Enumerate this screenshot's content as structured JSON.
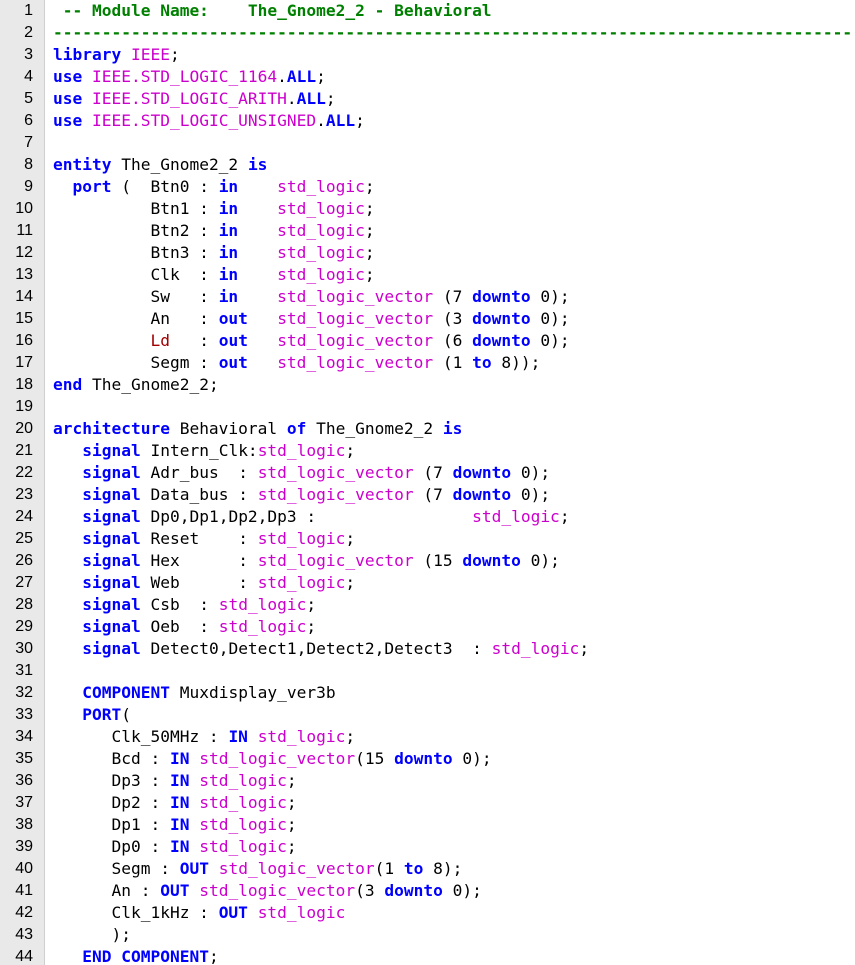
{
  "colors": {
    "keyword": "#0000ff",
    "type": "#cc00cc",
    "comment": "#008000",
    "identifier": "#000000",
    "highlight_identifier": "#a00000",
    "gutter_bg": "#e9e9e9"
  },
  "lines": [
    {
      "n": "1",
      "tokens": [
        {
          "t": "cm",
          "v": " -- Module Name:    The_Gnome2_2 - Behavioral"
        }
      ]
    },
    {
      "n": "2",
      "tokens": [
        {
          "t": "cm",
          "v": "----------------------------------------------------------------------------------"
        }
      ]
    },
    {
      "n": "3",
      "tokens": [
        {
          "t": "kw",
          "v": "library"
        },
        {
          "t": "id",
          "v": " "
        },
        {
          "t": "ty",
          "v": "IEEE"
        },
        {
          "t": "id",
          "v": ";"
        }
      ]
    },
    {
      "n": "4",
      "tokens": [
        {
          "t": "kw",
          "v": "use"
        },
        {
          "t": "id",
          "v": " "
        },
        {
          "t": "ty",
          "v": "IEEE.STD_LOGIC_1164"
        },
        {
          "t": "id",
          "v": "."
        },
        {
          "t": "kw",
          "v": "ALL"
        },
        {
          "t": "id",
          "v": ";"
        }
      ]
    },
    {
      "n": "5",
      "tokens": [
        {
          "t": "kw",
          "v": "use"
        },
        {
          "t": "id",
          "v": " "
        },
        {
          "t": "ty",
          "v": "IEEE.STD_LOGIC_ARITH"
        },
        {
          "t": "id",
          "v": "."
        },
        {
          "t": "kw",
          "v": "ALL"
        },
        {
          "t": "id",
          "v": ";"
        }
      ]
    },
    {
      "n": "6",
      "tokens": [
        {
          "t": "kw",
          "v": "use"
        },
        {
          "t": "id",
          "v": " "
        },
        {
          "t": "ty",
          "v": "IEEE.STD_LOGIC_UNSIGNED"
        },
        {
          "t": "id",
          "v": "."
        },
        {
          "t": "kw",
          "v": "ALL"
        },
        {
          "t": "id",
          "v": ";"
        }
      ]
    },
    {
      "n": "7",
      "tokens": []
    },
    {
      "n": "8",
      "tokens": [
        {
          "t": "kw",
          "v": "entity"
        },
        {
          "t": "id",
          "v": " The_Gnome2_2 "
        },
        {
          "t": "kw",
          "v": "is"
        }
      ]
    },
    {
      "n": "9",
      "tokens": [
        {
          "t": "id",
          "v": "  "
        },
        {
          "t": "kw",
          "v": "port"
        },
        {
          "t": "id",
          "v": " (  Btn0 : "
        },
        {
          "t": "kw",
          "v": "in"
        },
        {
          "t": "id",
          "v": "    "
        },
        {
          "t": "ty",
          "v": "std_logic"
        },
        {
          "t": "id",
          "v": ";"
        }
      ]
    },
    {
      "n": "10",
      "tokens": [
        {
          "t": "id",
          "v": "          Btn1 : "
        },
        {
          "t": "kw",
          "v": "in"
        },
        {
          "t": "id",
          "v": "    "
        },
        {
          "t": "ty",
          "v": "std_logic"
        },
        {
          "t": "id",
          "v": ";"
        }
      ]
    },
    {
      "n": "11",
      "tokens": [
        {
          "t": "id",
          "v": "          Btn2 : "
        },
        {
          "t": "kw",
          "v": "in"
        },
        {
          "t": "id",
          "v": "    "
        },
        {
          "t": "ty",
          "v": "std_logic"
        },
        {
          "t": "id",
          "v": ";"
        }
      ]
    },
    {
      "n": "12",
      "tokens": [
        {
          "t": "id",
          "v": "          Btn3 : "
        },
        {
          "t": "kw",
          "v": "in"
        },
        {
          "t": "id",
          "v": "    "
        },
        {
          "t": "ty",
          "v": "std_logic"
        },
        {
          "t": "id",
          "v": ";"
        }
      ]
    },
    {
      "n": "13",
      "tokens": [
        {
          "t": "id",
          "v": "          Clk  : "
        },
        {
          "t": "kw",
          "v": "in"
        },
        {
          "t": "id",
          "v": "    "
        },
        {
          "t": "ty",
          "v": "std_logic"
        },
        {
          "t": "id",
          "v": ";"
        }
      ]
    },
    {
      "n": "14",
      "tokens": [
        {
          "t": "id",
          "v": "          Sw   : "
        },
        {
          "t": "kw",
          "v": "in"
        },
        {
          "t": "id",
          "v": "    "
        },
        {
          "t": "ty",
          "v": "std_logic_vector"
        },
        {
          "t": "id",
          "v": " (7 "
        },
        {
          "t": "kw",
          "v": "downto"
        },
        {
          "t": "id",
          "v": " 0);"
        }
      ]
    },
    {
      "n": "15",
      "tokens": [
        {
          "t": "id",
          "v": "          An   : "
        },
        {
          "t": "kw",
          "v": "out"
        },
        {
          "t": "id",
          "v": "   "
        },
        {
          "t": "ty",
          "v": "std_logic_vector"
        },
        {
          "t": "id",
          "v": " (3 "
        },
        {
          "t": "kw",
          "v": "downto"
        },
        {
          "t": "id",
          "v": " 0);"
        }
      ]
    },
    {
      "n": "16",
      "tokens": [
        {
          "t": "id",
          "v": "          "
        },
        {
          "t": "rd",
          "v": "Ld"
        },
        {
          "t": "id",
          "v": "   : "
        },
        {
          "t": "kw",
          "v": "out"
        },
        {
          "t": "id",
          "v": "   "
        },
        {
          "t": "ty",
          "v": "std_logic_vector"
        },
        {
          "t": "id",
          "v": " (6 "
        },
        {
          "t": "kw",
          "v": "downto"
        },
        {
          "t": "id",
          "v": " 0);"
        }
      ]
    },
    {
      "n": "17",
      "tokens": [
        {
          "t": "id",
          "v": "          Segm : "
        },
        {
          "t": "kw",
          "v": "out"
        },
        {
          "t": "id",
          "v": "   "
        },
        {
          "t": "ty",
          "v": "std_logic_vector"
        },
        {
          "t": "id",
          "v": " (1 "
        },
        {
          "t": "kw",
          "v": "to"
        },
        {
          "t": "id",
          "v": " 8));"
        }
      ]
    },
    {
      "n": "18",
      "tokens": [
        {
          "t": "kw",
          "v": "end"
        },
        {
          "t": "id",
          "v": " The_Gnome2_2;"
        }
      ]
    },
    {
      "n": "19",
      "tokens": []
    },
    {
      "n": "20",
      "tokens": [
        {
          "t": "kw",
          "v": "architecture"
        },
        {
          "t": "id",
          "v": " Behavioral "
        },
        {
          "t": "kw",
          "v": "of"
        },
        {
          "t": "id",
          "v": " The_Gnome2_2 "
        },
        {
          "t": "kw",
          "v": "is"
        }
      ]
    },
    {
      "n": "21",
      "tokens": [
        {
          "t": "id",
          "v": "   "
        },
        {
          "t": "kw",
          "v": "signal"
        },
        {
          "t": "id",
          "v": " Intern_Clk:"
        },
        {
          "t": "ty",
          "v": "std_logic"
        },
        {
          "t": "id",
          "v": ";"
        }
      ]
    },
    {
      "n": "22",
      "tokens": [
        {
          "t": "id",
          "v": "   "
        },
        {
          "t": "kw",
          "v": "signal"
        },
        {
          "t": "id",
          "v": " Adr_bus  : "
        },
        {
          "t": "ty",
          "v": "std_logic_vector"
        },
        {
          "t": "id",
          "v": " (7 "
        },
        {
          "t": "kw",
          "v": "downto"
        },
        {
          "t": "id",
          "v": " 0);"
        }
      ]
    },
    {
      "n": "23",
      "tokens": [
        {
          "t": "id",
          "v": "   "
        },
        {
          "t": "kw",
          "v": "signal"
        },
        {
          "t": "id",
          "v": " Data_bus : "
        },
        {
          "t": "ty",
          "v": "std_logic_vector"
        },
        {
          "t": "id",
          "v": " (7 "
        },
        {
          "t": "kw",
          "v": "downto"
        },
        {
          "t": "id",
          "v": " 0);"
        }
      ]
    },
    {
      "n": "24",
      "tokens": [
        {
          "t": "id",
          "v": "   "
        },
        {
          "t": "kw",
          "v": "signal"
        },
        {
          "t": "id",
          "v": " Dp0,Dp1,Dp2,Dp3 :                "
        },
        {
          "t": "ty",
          "v": "std_logic"
        },
        {
          "t": "id",
          "v": ";"
        }
      ]
    },
    {
      "n": "25",
      "tokens": [
        {
          "t": "id",
          "v": "   "
        },
        {
          "t": "kw",
          "v": "signal"
        },
        {
          "t": "id",
          "v": " Reset    : "
        },
        {
          "t": "ty",
          "v": "std_logic"
        },
        {
          "t": "id",
          "v": ";"
        }
      ]
    },
    {
      "n": "26",
      "tokens": [
        {
          "t": "id",
          "v": "   "
        },
        {
          "t": "kw",
          "v": "signal"
        },
        {
          "t": "id",
          "v": " Hex      : "
        },
        {
          "t": "ty",
          "v": "std_logic_vector"
        },
        {
          "t": "id",
          "v": " (15 "
        },
        {
          "t": "kw",
          "v": "downto"
        },
        {
          "t": "id",
          "v": " 0);"
        }
      ]
    },
    {
      "n": "27",
      "tokens": [
        {
          "t": "id",
          "v": "   "
        },
        {
          "t": "kw",
          "v": "signal"
        },
        {
          "t": "id",
          "v": " Web      : "
        },
        {
          "t": "ty",
          "v": "std_logic"
        },
        {
          "t": "id",
          "v": ";"
        }
      ]
    },
    {
      "n": "28",
      "tokens": [
        {
          "t": "id",
          "v": "   "
        },
        {
          "t": "kw",
          "v": "signal"
        },
        {
          "t": "id",
          "v": " Csb  : "
        },
        {
          "t": "ty",
          "v": "std_logic"
        },
        {
          "t": "id",
          "v": ";"
        }
      ]
    },
    {
      "n": "29",
      "tokens": [
        {
          "t": "id",
          "v": "   "
        },
        {
          "t": "kw",
          "v": "signal"
        },
        {
          "t": "id",
          "v": " Oeb  : "
        },
        {
          "t": "ty",
          "v": "std_logic"
        },
        {
          "t": "id",
          "v": ";"
        }
      ]
    },
    {
      "n": "30",
      "tokens": [
        {
          "t": "id",
          "v": "   "
        },
        {
          "t": "kw",
          "v": "signal"
        },
        {
          "t": "id",
          "v": " Detect0,Detect1,Detect2,Detect3  : "
        },
        {
          "t": "ty",
          "v": "std_logic"
        },
        {
          "t": "id",
          "v": ";"
        }
      ]
    },
    {
      "n": "31",
      "tokens": []
    },
    {
      "n": "32",
      "tokens": [
        {
          "t": "id",
          "v": "   "
        },
        {
          "t": "kw",
          "v": "COMPONENT"
        },
        {
          "t": "id",
          "v": " Muxdisplay_ver3b"
        }
      ]
    },
    {
      "n": "33",
      "tokens": [
        {
          "t": "id",
          "v": "   "
        },
        {
          "t": "kw",
          "v": "PORT"
        },
        {
          "t": "id",
          "v": "("
        }
      ]
    },
    {
      "n": "34",
      "tokens": [
        {
          "t": "id",
          "v": "      Clk_50MHz : "
        },
        {
          "t": "kw",
          "v": "IN"
        },
        {
          "t": "id",
          "v": " "
        },
        {
          "t": "ty",
          "v": "std_logic"
        },
        {
          "t": "id",
          "v": ";"
        }
      ]
    },
    {
      "n": "35",
      "tokens": [
        {
          "t": "id",
          "v": "      Bcd : "
        },
        {
          "t": "kw",
          "v": "IN"
        },
        {
          "t": "id",
          "v": " "
        },
        {
          "t": "ty",
          "v": "std_logic_vector"
        },
        {
          "t": "id",
          "v": "(15 "
        },
        {
          "t": "kw",
          "v": "downto"
        },
        {
          "t": "id",
          "v": " 0);"
        }
      ]
    },
    {
      "n": "36",
      "tokens": [
        {
          "t": "id",
          "v": "      Dp3 : "
        },
        {
          "t": "kw",
          "v": "IN"
        },
        {
          "t": "id",
          "v": " "
        },
        {
          "t": "ty",
          "v": "std_logic"
        },
        {
          "t": "id",
          "v": ";"
        }
      ]
    },
    {
      "n": "37",
      "tokens": [
        {
          "t": "id",
          "v": "      Dp2 : "
        },
        {
          "t": "kw",
          "v": "IN"
        },
        {
          "t": "id",
          "v": " "
        },
        {
          "t": "ty",
          "v": "std_logic"
        },
        {
          "t": "id",
          "v": ";"
        }
      ]
    },
    {
      "n": "38",
      "tokens": [
        {
          "t": "id",
          "v": "      Dp1 : "
        },
        {
          "t": "kw",
          "v": "IN"
        },
        {
          "t": "id",
          "v": " "
        },
        {
          "t": "ty",
          "v": "std_logic"
        },
        {
          "t": "id",
          "v": ";"
        }
      ]
    },
    {
      "n": "39",
      "tokens": [
        {
          "t": "id",
          "v": "      Dp0 : "
        },
        {
          "t": "kw",
          "v": "IN"
        },
        {
          "t": "id",
          "v": " "
        },
        {
          "t": "ty",
          "v": "std_logic"
        },
        {
          "t": "id",
          "v": ";"
        }
      ]
    },
    {
      "n": "40",
      "tokens": [
        {
          "t": "id",
          "v": "      Segm : "
        },
        {
          "t": "kw",
          "v": "OUT"
        },
        {
          "t": "id",
          "v": " "
        },
        {
          "t": "ty",
          "v": "std_logic_vector"
        },
        {
          "t": "id",
          "v": "(1 "
        },
        {
          "t": "kw",
          "v": "to"
        },
        {
          "t": "id",
          "v": " 8);"
        }
      ]
    },
    {
      "n": "41",
      "tokens": [
        {
          "t": "id",
          "v": "      An : "
        },
        {
          "t": "kw",
          "v": "OUT"
        },
        {
          "t": "id",
          "v": " "
        },
        {
          "t": "ty",
          "v": "std_logic_vector"
        },
        {
          "t": "id",
          "v": "(3 "
        },
        {
          "t": "kw",
          "v": "downto"
        },
        {
          "t": "id",
          "v": " 0);"
        }
      ]
    },
    {
      "n": "42",
      "tokens": [
        {
          "t": "id",
          "v": "      Clk_1kHz : "
        },
        {
          "t": "kw",
          "v": "OUT"
        },
        {
          "t": "id",
          "v": " "
        },
        {
          "t": "ty",
          "v": "std_logic"
        }
      ]
    },
    {
      "n": "43",
      "tokens": [
        {
          "t": "id",
          "v": "      );"
        }
      ]
    },
    {
      "n": "44",
      "tokens": [
        {
          "t": "id",
          "v": "   "
        },
        {
          "t": "kw",
          "v": "END"
        },
        {
          "t": "id",
          "v": " "
        },
        {
          "t": "kw",
          "v": "COMPONENT"
        },
        {
          "t": "id",
          "v": ";"
        }
      ]
    }
  ]
}
